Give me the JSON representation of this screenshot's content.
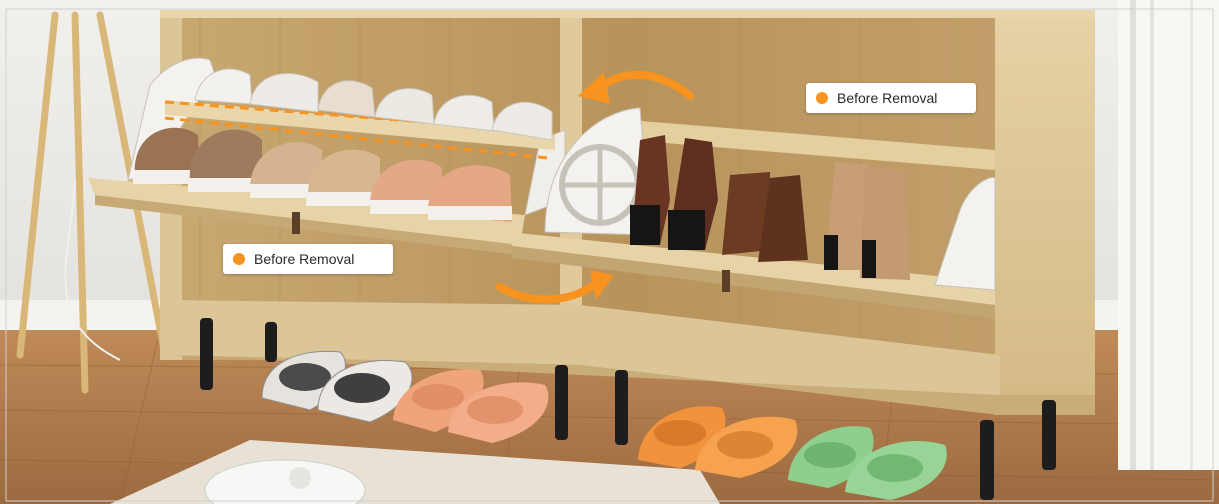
{
  "annotations": {
    "left": {
      "text": "Before Removal"
    },
    "right": {
      "text": "Before Removal"
    }
  },
  "colors": {
    "accent_orange": "#f7931e",
    "wood": "#d9c190",
    "wood_dark": "#b89a66",
    "floor": "#b07b4d",
    "wall": "#ecebe7"
  },
  "icons": {
    "arrow_top": "curved-arrow-left-icon",
    "arrow_bottom": "curved-arrow-right-icon",
    "dashed_line": "dashed-guide-line"
  }
}
